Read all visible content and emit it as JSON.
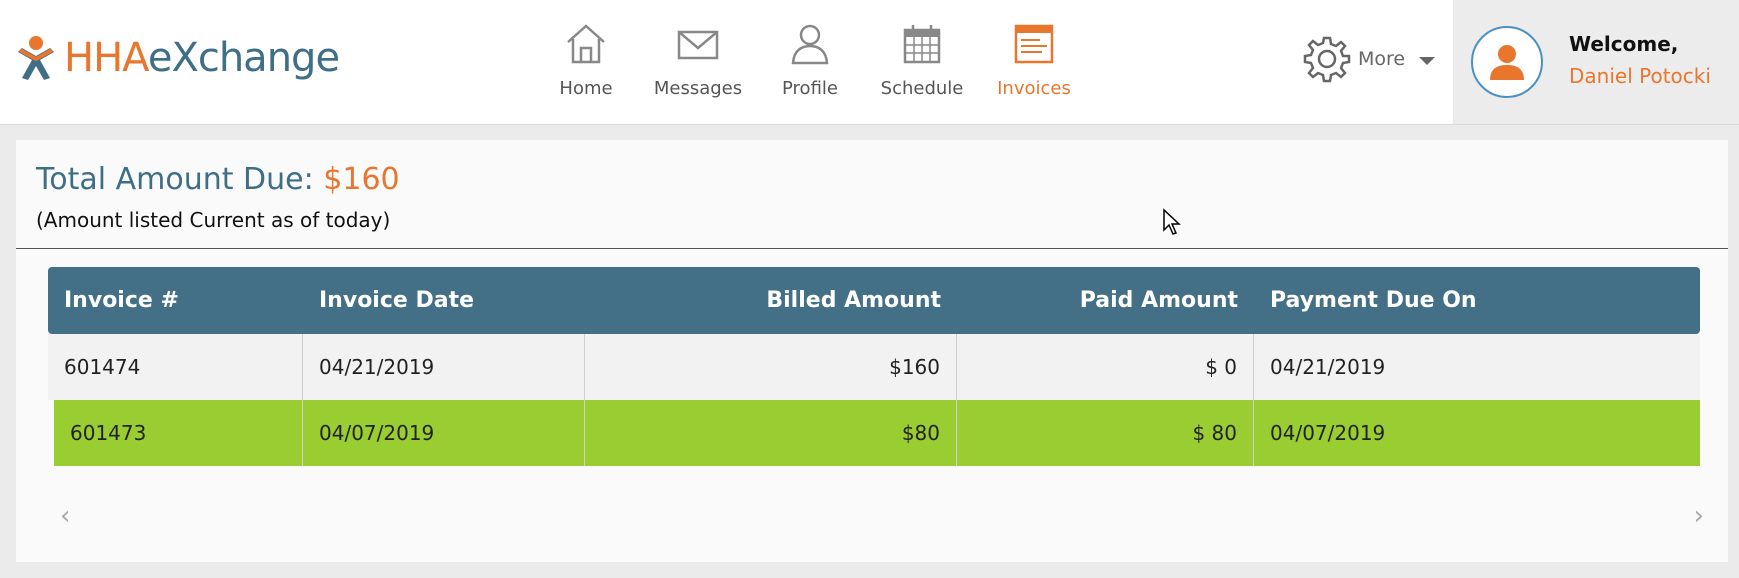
{
  "app": {
    "logo_hha": "HHA",
    "logo_rest": "eXchange",
    "brand_orange": "#e8762d",
    "brand_blue": "#3e6f87"
  },
  "nav": {
    "items": [
      {
        "label": "Home",
        "icon": "home-icon"
      },
      {
        "label": "Messages",
        "icon": "envelope-icon"
      },
      {
        "label": "Profile",
        "icon": "user-icon"
      },
      {
        "label": "Schedule",
        "icon": "calendar-icon"
      },
      {
        "label": "Invoices",
        "icon": "invoice-icon",
        "active": true
      }
    ],
    "more_label": "More"
  },
  "user": {
    "welcome": "Welcome,",
    "name": "Daniel Potocki"
  },
  "summary": {
    "total_label": "Total Amount Due:",
    "total_amount": "$160",
    "note": "(Amount listed Current as of today)"
  },
  "table": {
    "headers": [
      "Invoice #",
      "Invoice Date",
      "Billed Amount",
      "Paid Amount",
      "Payment Due On"
    ],
    "rows": [
      {
        "invoice": "601474",
        "date": "04/21/2019",
        "billed": "$160",
        "paid": "$ 0",
        "due": "04/21/2019",
        "status": "unpaid"
      },
      {
        "invoice": "601473",
        "date": "04/07/2019",
        "billed": "$80",
        "paid": "$ 80",
        "due": "04/07/2019",
        "status": "paid"
      }
    ],
    "header_color": "#436f87",
    "paid_row_color": "#9acd32"
  }
}
